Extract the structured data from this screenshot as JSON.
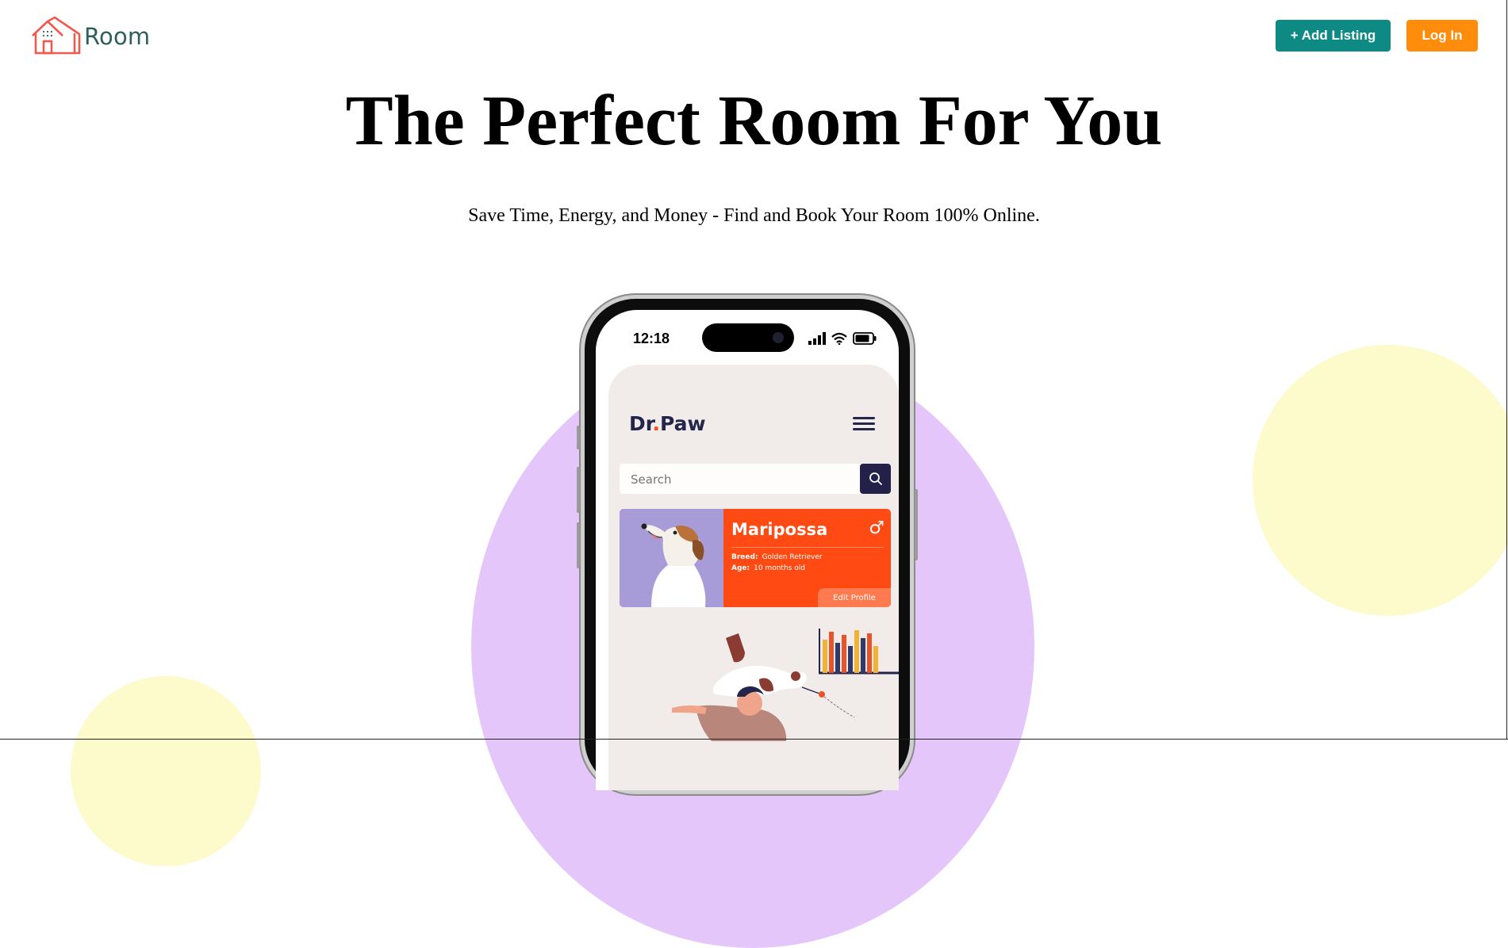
{
  "header": {
    "logo_text": "Room",
    "add_listing_label": "+ Add Listing",
    "login_label": "Log In"
  },
  "hero": {
    "title": "The Perfect Room For You",
    "subtitle": "Save Time, Energy, and Money - Find and Book Your Room 100% Online."
  },
  "phone": {
    "time": "12:18",
    "app": {
      "logo_part1": "Dr",
      "logo_dot": ".",
      "logo_part2": "Paw",
      "search_placeholder": "Search",
      "pet_card": {
        "name": "Maripossa",
        "gender_symbol": "♂",
        "breed_label": "Breed:",
        "breed_value": "Golden Retriever",
        "age_label": "Age:",
        "age_value": "10 months old",
        "edit_label": "Edit Profile"
      }
    }
  },
  "colors": {
    "brand_teal": "#0e8a85",
    "brand_orange": "#ff8c0a",
    "logo_red": "#ef5a4f",
    "app_accent": "#ff4a13",
    "app_navy": "#23254b",
    "purple_blob": "#e4c6fb",
    "yellow_blob": "#fdfacb"
  }
}
